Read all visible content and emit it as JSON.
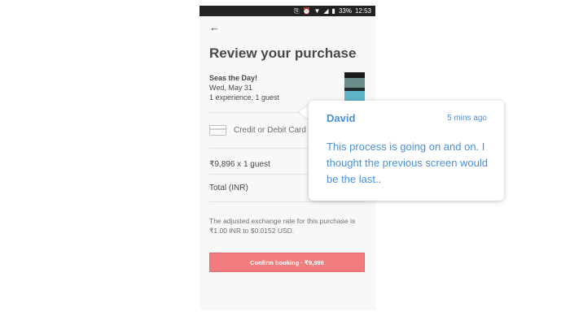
{
  "status_bar": {
    "battery": "33%",
    "time": "12:53",
    "icons": [
      "vibrate-icon",
      "alarm-icon",
      "wifi-icon",
      "signal-icon",
      "battery-icon"
    ]
  },
  "header": {
    "back_icon": "back-arrow-icon",
    "title": "Review your purchase"
  },
  "experience": {
    "name": "Seas the Day!",
    "date": "Wed, May 31",
    "count": "1 experience, 1 guest"
  },
  "payment": {
    "icon": "credit-card-icon",
    "label": "Credit or Debit Card"
  },
  "pricing": {
    "line": "₹9,896 x 1 guest",
    "total_label": "Total (INR)"
  },
  "note": "The adjusted exchange rate for this purchase is ₹1.00 INR to $0.0152 USD.",
  "confirm_button": "Confirm booking · ₹9,896",
  "comment": {
    "author": "David",
    "time": "5 mins ago",
    "message": "This process is going on and on. I thought the previous screen would be the last.."
  },
  "colors": {
    "accent": "#f27b7b",
    "comment": "#4a90d9",
    "status_bar": "#222222"
  }
}
